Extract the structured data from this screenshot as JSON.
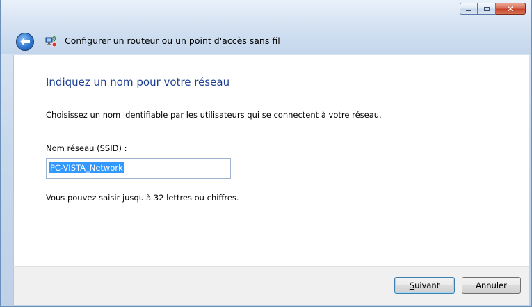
{
  "window": {
    "title": "Configurer un routeur ou un point d'accès sans fil",
    "controls": {
      "minimize": "",
      "maximize": "",
      "close": "✕"
    }
  },
  "main": {
    "heading": "Indiquez un nom pour votre réseau",
    "description": "Choisissez un nom identifiable par les utilisateurs qui se connectent à votre réseau.",
    "ssid_label": "Nom réseau (SSID) :",
    "ssid_value": "PC-VISTA_Network",
    "hint": "Vous pouvez saisir jusqu'à 32 lettres ou chiffres."
  },
  "footer": {
    "next_label_access": "S",
    "next_label_rest": "uivant",
    "cancel_label": "Annuler"
  },
  "icons": {
    "back": "back-arrow-icon",
    "app": "network-setup-icon"
  },
  "colors": {
    "heading": "#1e3f8f",
    "selection": "#3399ff",
    "close_button": "#c7432a"
  }
}
